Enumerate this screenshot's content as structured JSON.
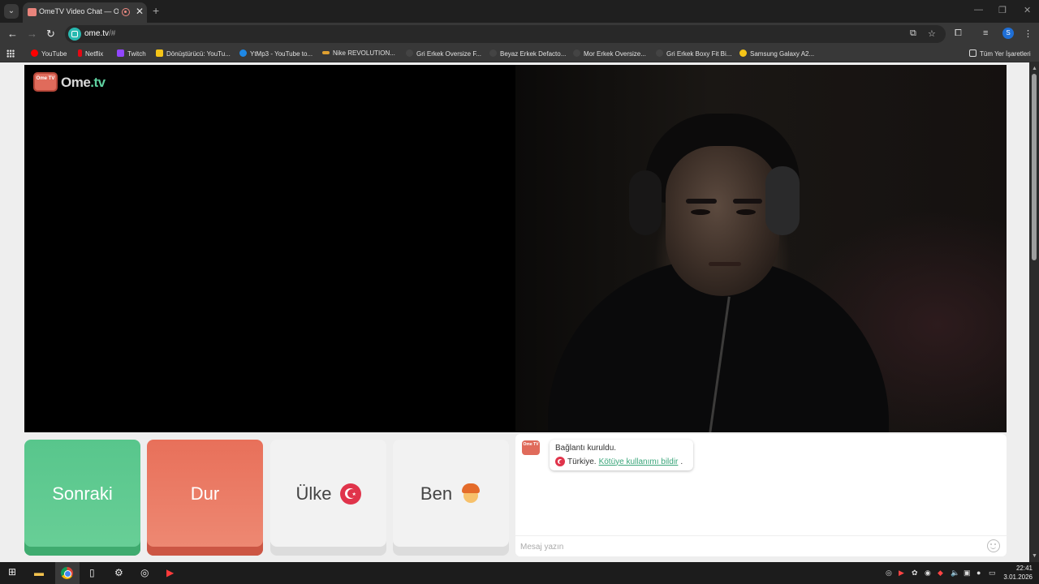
{
  "browser": {
    "tab_title": "OmeTV Video Chat — Ome",
    "tab_close": "✕",
    "new_tab": "+",
    "url_host": "ome.tv",
    "url_path": "/#",
    "profile_initial": "S",
    "window_controls": [
      "—",
      "❐",
      "✕"
    ]
  },
  "bookmarks": [
    {
      "label": "YouTube",
      "color": "#ff0000"
    },
    {
      "label": "Netflix",
      "color": "#e50914"
    },
    {
      "label": "Twitch",
      "color": "#9146ff"
    },
    {
      "label": "Dönüştürücü: YouTu...",
      "color": "#f5c518"
    },
    {
      "label": "YtMp3 - YouTube to...",
      "color": "#1e88e5"
    },
    {
      "label": "Nike REVOLUTION...",
      "color": "#e0a030"
    },
    {
      "label": "Gri Erkek Oversize F...",
      "color": "#333333"
    },
    {
      "label": "Beyaz Erkek Defacto...",
      "color": "#333333"
    },
    {
      "label": "Mor Erkek Oversize...",
      "color": "#333333"
    },
    {
      "label": "Gri Erkek Boxy Fit Bi...",
      "color": "#333333"
    },
    {
      "label": "Samsung Galaxy A2...",
      "color": "#f5c518"
    }
  ],
  "bookmarks_all": "Tüm Yer İşaretleri",
  "logo": {
    "badge": "Ome TV",
    "word_prefix": "Ome",
    "word_suffix": ".tv"
  },
  "controls": {
    "next": "Sonraki",
    "stop": "Dur",
    "country": "Ülke",
    "me": "Ben"
  },
  "chat": {
    "logo_badge": "Ome TV",
    "line1": "Bağlantı kuruldu.",
    "country": "Türkiye.",
    "report_link": "Kötüye kullanımı bildir",
    "report_suffix": ".",
    "placeholder": "Mesaj yazın"
  },
  "taskbar": {
    "time": "22:41",
    "date": "3.01.2026"
  },
  "colors": {
    "next": "#58c68c",
    "stop": "#e8705a",
    "accent_link": "#3aa57a",
    "flag_red": "#e0344b"
  }
}
